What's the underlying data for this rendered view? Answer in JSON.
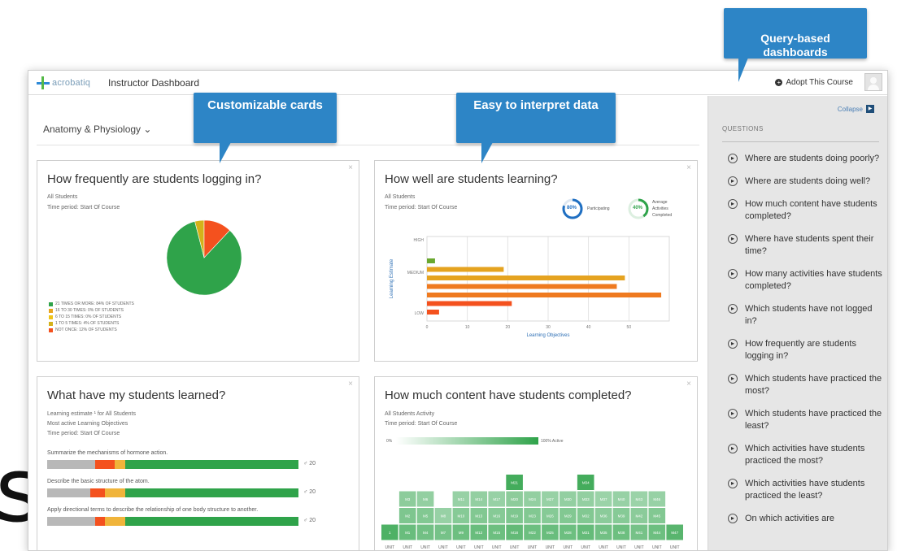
{
  "window": {
    "logo_text": "acrobatiq",
    "title": "Instructor Dashboard",
    "adopt_label": "Adopt This Course"
  },
  "course_selector": "Anatomy & Physiology ⌄",
  "callouts": {
    "cards": "Customizable cards",
    "data": "Easy to interpret data",
    "dashboards": "Query-based\ndashboards"
  },
  "card_close": "×",
  "login_card": {
    "title": "How frequently are students logging in?",
    "scope": "All Students",
    "period": "Time period: Start Of Course",
    "legend": [
      {
        "label": "21 TIMES OR MORE: 84% OF STUDENTS",
        "color": "#2fa34a"
      },
      {
        "label": "16 TO 30 TIMES: 0% OF STUDENTS",
        "color": "#e8a51f"
      },
      {
        "label": "6 TO 15 TIMES: 0% OF STUDENTS",
        "color": "#f0c419"
      },
      {
        "label": "1 TO 5 TIMES: 4% OF STUDENTS",
        "color": "#d4b21a"
      },
      {
        "label": "NOT ONCE: 12% OF STUDENTS",
        "color": "#f4511e"
      }
    ],
    "pie": [
      84,
      4,
      12
    ]
  },
  "learning_card": {
    "title": "How well are students learning?",
    "scope": "All Students",
    "period": "Time period: Start Of Course",
    "participating": {
      "value": "80%",
      "label": "Participating",
      "color": "#1f6fc2",
      "fraction": 0.8
    },
    "completed": {
      "value": "40%",
      "label_1": "Average",
      "label_2": "Activities",
      "label_3": "Completed",
      "color": "#2fa34a",
      "fraction": 0.4
    },
    "chart_data": {
      "type": "bar",
      "orientation": "horizontal",
      "xlabel": "Learning Objectives",
      "ylabel": "Learning Estimate",
      "xlim": [
        0,
        60
      ],
      "xticks": [
        "0",
        "10",
        "20",
        "30",
        "40",
        "50"
      ],
      "y_levels": [
        "HIGH",
        "MEDIUM",
        "LOW"
      ],
      "series": [
        {
          "values": [
            2
          ],
          "color": "#6aa82f",
          "level": "HIGH"
        },
        {
          "values": [
            19
          ],
          "color": "#e5a320",
          "level": "MEDIUM"
        },
        {
          "values": [
            49
          ],
          "color": "#e5a320",
          "level": "MEDIUM"
        },
        {
          "values": [
            47
          ],
          "color": "#ef7a1f",
          "level": "MEDIUM"
        },
        {
          "values": [
            58
          ],
          "color": "#ef7a1f",
          "level": "LOW"
        },
        {
          "values": [
            21
          ],
          "color": "#f4511e",
          "level": "LOW"
        },
        {
          "values": [
            3
          ],
          "color": "#f4511e",
          "level": "LOW"
        }
      ]
    }
  },
  "learned_card": {
    "title": "What have my students learned?",
    "estimate_line": "Learning estimate ¹  for All Students",
    "subtitle": "Most active Learning Objectives",
    "period": "Time period: Start Of Course",
    "objectives": [
      {
        "label": "Summarize the mechanisms of hormone action.",
        "count": "♂ 20",
        "segments": [
          {
            "fraction": 0.19,
            "color": "#b8b8b8"
          },
          {
            "fraction": 0.08,
            "color": "#f4511e"
          },
          {
            "fraction": 0.04,
            "color": "#f0b43a"
          },
          {
            "fraction": 0.69,
            "color": "#2fa34a"
          }
        ]
      },
      {
        "label": "Describe the basic structure of the atom.",
        "count": "♂ 20",
        "segments": [
          {
            "fraction": 0.17,
            "color": "#b8b8b8"
          },
          {
            "fraction": 0.06,
            "color": "#f4511e"
          },
          {
            "fraction": 0.08,
            "color": "#f0b43a"
          },
          {
            "fraction": 0.69,
            "color": "#2fa34a"
          }
        ]
      },
      {
        "label": "Apply directional terms to describe the relationship of one body structure to another.",
        "count": "♂ 20",
        "segments": [
          {
            "fraction": 0.19,
            "color": "#b8b8b8"
          },
          {
            "fraction": 0.04,
            "color": "#f4511e"
          },
          {
            "fraction": 0.08,
            "color": "#f0b43a"
          },
          {
            "fraction": 0.69,
            "color": "#2fa34a"
          }
        ]
      }
    ]
  },
  "content_card": {
    "title": "How much content have students completed?",
    "scope": "All Students Activity",
    "period": "Time period: Start Of Course",
    "scale_min": "0%",
    "scale_max": "100% Active",
    "chart_data": {
      "type": "heatmap",
      "columns": [
        "UNIT 1",
        "UNIT 2",
        "UNIT 3",
        "UNIT 4",
        "UNIT 5",
        "UNIT 6",
        "UNIT 7",
        "UNIT 8",
        "UNIT 9",
        "UNIT 10",
        "UNIT 11",
        "UNIT 12",
        "UNIT 13",
        "UNIT 14",
        "UNIT 15",
        "UNIT 16",
        "UNIT 17"
      ],
      "cells": [
        [
          [
            "1"
          ],
          [
            "M1",
            "M2",
            "M3"
          ],
          [
            "M4",
            "M5",
            "M6"
          ],
          [
            "M7",
            "M8"
          ],
          [
            "M9",
            "M10",
            "M11"
          ],
          [
            "M12",
            "M13",
            "M14"
          ],
          [
            "M15",
            "M16",
            "M17"
          ],
          [
            "M18",
            "M19",
            "M20",
            "M21"
          ],
          [
            "M22",
            "M23",
            "M24"
          ],
          [
            "M25",
            "M26",
            "M27"
          ],
          [
            "M28",
            "M29",
            "M30"
          ],
          [
            "M31",
            "M32",
            "M33",
            "M34"
          ],
          [
            "M35",
            "M36",
            "M37"
          ],
          [
            "M38",
            "M39",
            "M40"
          ],
          [
            "M41",
            "M42",
            "M43"
          ],
          [
            "M44",
            "M45",
            "M46"
          ],
          [
            "M47"
          ]
        ]
      ],
      "activity": [
        [
          0.85
        ],
        [
          0.72,
          0.62,
          0.55
        ],
        [
          0.68,
          0.6,
          0.52
        ],
        [
          0.66,
          0.5
        ],
        [
          0.7,
          0.58,
          0.5
        ],
        [
          0.72,
          0.6,
          0.52
        ],
        [
          0.7,
          0.58,
          0.5
        ],
        [
          0.75,
          0.62,
          0.55,
          0.9
        ],
        [
          0.7,
          0.6,
          0.52
        ],
        [
          0.72,
          0.58,
          0.5
        ],
        [
          0.7,
          0.6,
          0.52
        ],
        [
          0.74,
          0.6,
          0.52,
          0.9
        ],
        [
          0.68,
          0.56,
          0.48
        ],
        [
          0.7,
          0.58,
          0.5
        ],
        [
          0.66,
          0.56,
          0.48
        ],
        [
          0.7,
          0.6,
          0.5
        ],
        [
          0.8
        ]
      ]
    }
  },
  "sidebar": {
    "collapse_label": "Collapse",
    "collapse_icon": "▶",
    "questions_heading": "QUESTIONS",
    "question_icon": "▸",
    "questions": [
      "Where are students doing poorly?",
      "Where are students doing well?",
      "How much content have students completed?",
      "Where have students spent their time?",
      "How many activities have students completed?",
      "Which students have not logged in?",
      "How frequently are students logging in?",
      "Which students have practiced the most?",
      "Which students have practiced the least?",
      "Which activities have students practiced the most?",
      "Which activities have students practiced the least?",
      "On which activities are"
    ]
  },
  "colors": {
    "callout": "#2d85c6",
    "accent_blue": "#1f6fc2",
    "green": "#2fa34a",
    "orange": "#f4511e"
  }
}
